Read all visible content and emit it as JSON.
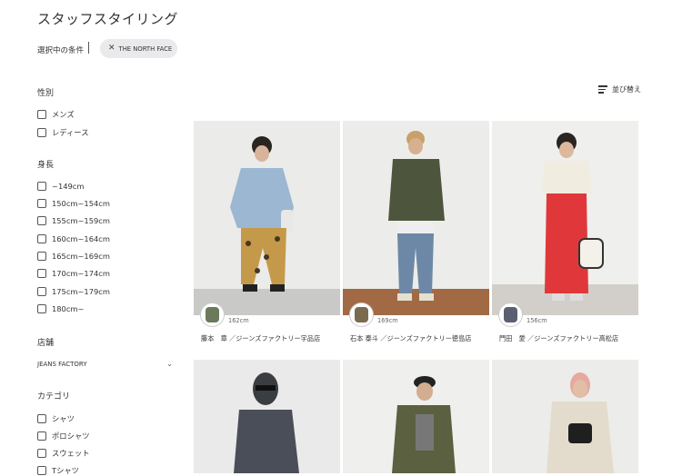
{
  "title": "スタッフスタイリング",
  "conditions": {
    "label": "選択中の条件",
    "chip": "THE NORTH FACE"
  },
  "sort_label": "並び替え",
  "filters": {
    "gender": {
      "heading": "性別",
      "options": [
        "メンズ",
        "レディース"
      ]
    },
    "height": {
      "heading": "身長",
      "options": [
        "~149cm",
        "150cm~154cm",
        "155cm~159cm",
        "160cm~164cm",
        "165cm~169cm",
        "170cm~174cm",
        "175cm~179cm",
        "180cm~"
      ]
    },
    "store": {
      "heading": "店舗",
      "selected": "JEANS FACTORY"
    },
    "category": {
      "heading": "カテゴリ",
      "options": [
        "シャツ",
        "ポロシャツ",
        "スウェット",
        "Tシャツ"
      ]
    }
  },
  "cards": [
    {
      "height": "162cm",
      "staff": "藤本　章 ／ジーンズファクトリー宇品店"
    },
    {
      "height": "169cm",
      "staff": "石本 泰斗 ／ジーンズファクトリー徳島店"
    },
    {
      "height": "156cm",
      "staff": "門田　愛 ／ジーンズファクトリー高松店"
    }
  ],
  "colors": {
    "chip_bg": "#eaeaec",
    "text": "#333333"
  }
}
